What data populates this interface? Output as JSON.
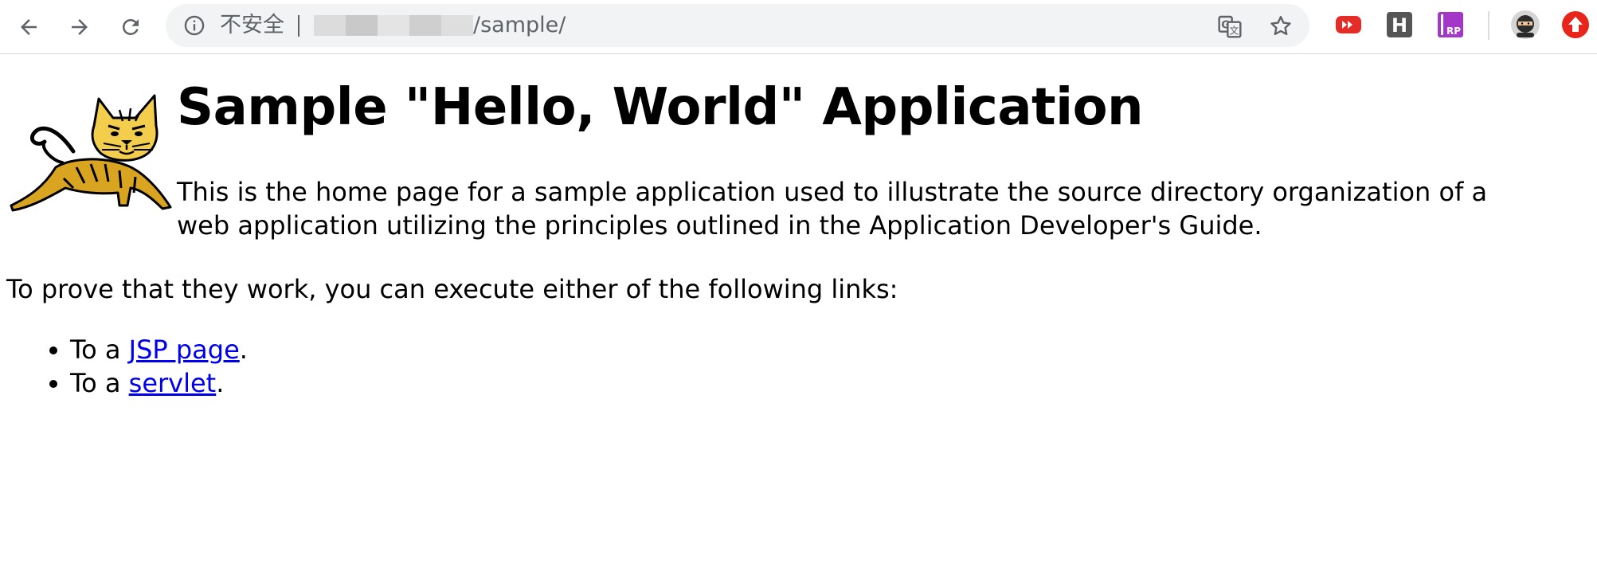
{
  "browser": {
    "security_label": "不安全",
    "url_path": "/sample/",
    "extensions": [
      "youtube-extension-icon",
      "h-extension-icon",
      "rp-extension-icon",
      "ninja-avatar-icon",
      "upload-extension-icon"
    ]
  },
  "page": {
    "title": "Sample \"Hello, World\" Application",
    "intro": "This is the home page for a sample application used to illustrate the source directory organization of a web application utilizing the principles outlined in the Application Developer's Guide.",
    "prove_text": "To prove that they work, you can execute either of the following links:",
    "links": [
      {
        "prefix": "To a ",
        "link_text": "JSP page",
        "suffix": "."
      },
      {
        "prefix": "To a ",
        "link_text": "servlet",
        "suffix": "."
      }
    ]
  },
  "colors": {
    "link": "#0000ee",
    "omnibox_bg": "#f1f3f4",
    "toolbar_icon": "#5f6368"
  }
}
